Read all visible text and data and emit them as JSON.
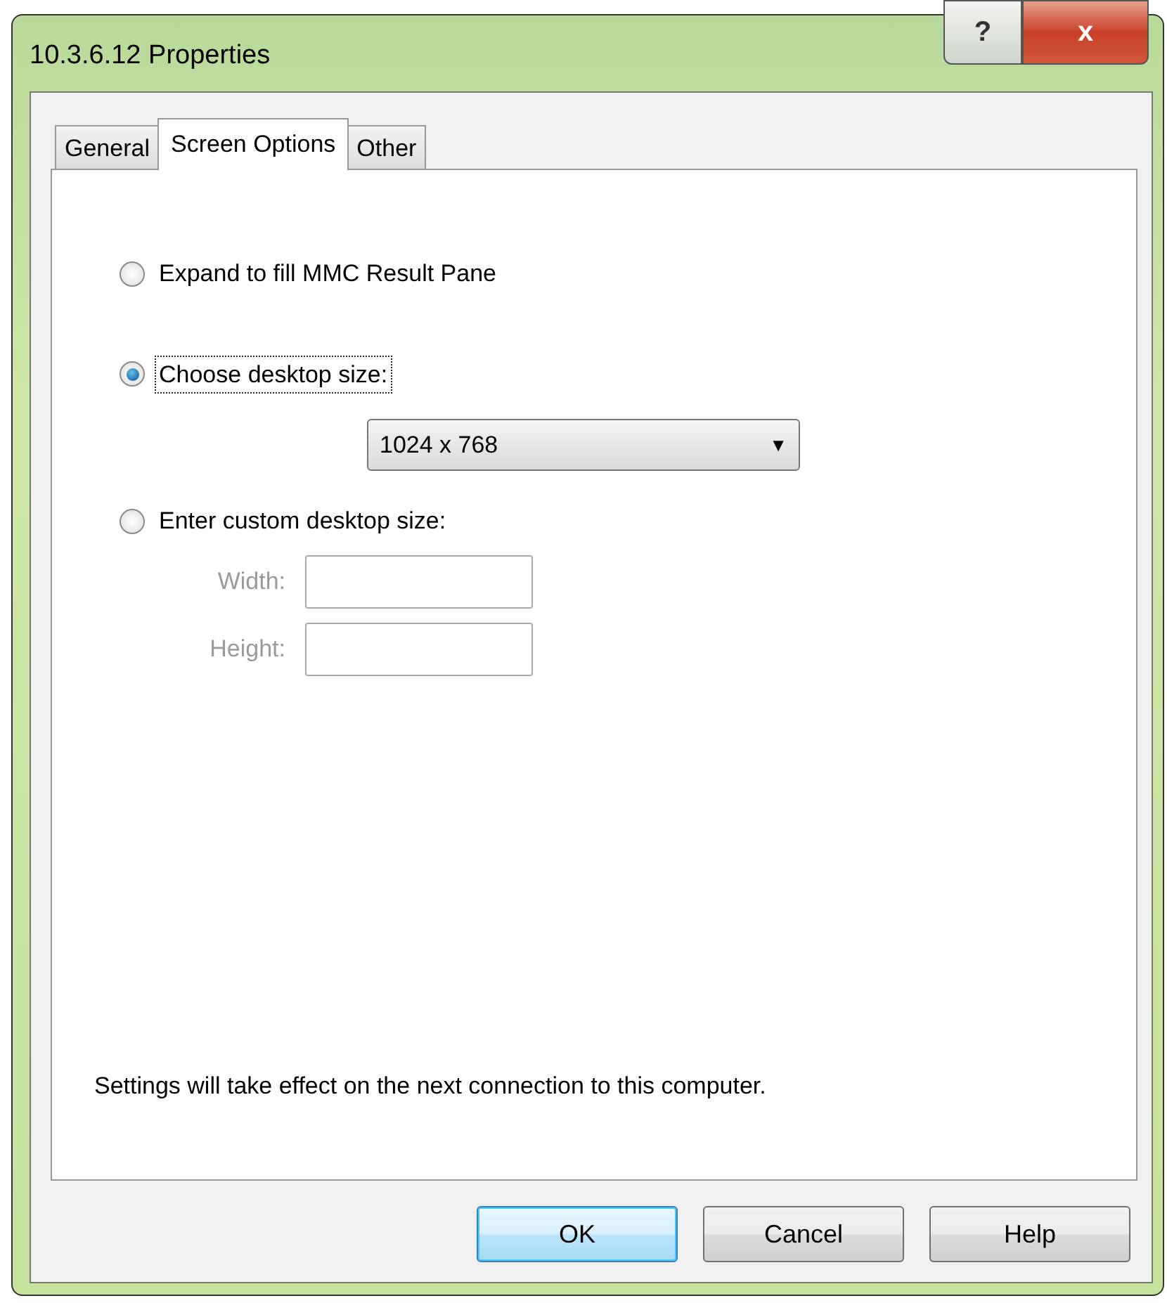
{
  "window": {
    "title": "10.3.6.12 Properties",
    "title_buttons": [
      {
        "kind": "help",
        "label": "?"
      },
      {
        "kind": "close",
        "label": "x"
      }
    ]
  },
  "tabs": [
    {
      "label": "General",
      "selected": false
    },
    {
      "label": "Screen Options",
      "selected": true
    },
    {
      "label": "Other",
      "selected": false
    }
  ],
  "options": [
    {
      "label": "Expand to fill MMC Result Pane",
      "selected": false,
      "focused": false
    },
    {
      "label": "Choose desktop size:",
      "selected": true,
      "focused": true
    },
    {
      "label": "Enter custom desktop size:",
      "selected": false,
      "focused": false
    }
  ],
  "desktop_size": {
    "value": "1024 x 768",
    "arrow": "▼"
  },
  "custom_size": [
    {
      "label": "Width:",
      "disabled": true
    },
    {
      "label": "Height:",
      "disabled": true
    }
  ],
  "note": "Settings will take effect on the next connection to this computer.",
  "buttons": [
    {
      "label": "OK",
      "default": true
    },
    {
      "label": "Cancel",
      "default": false
    },
    {
      "label": "Help",
      "default": false
    }
  ]
}
